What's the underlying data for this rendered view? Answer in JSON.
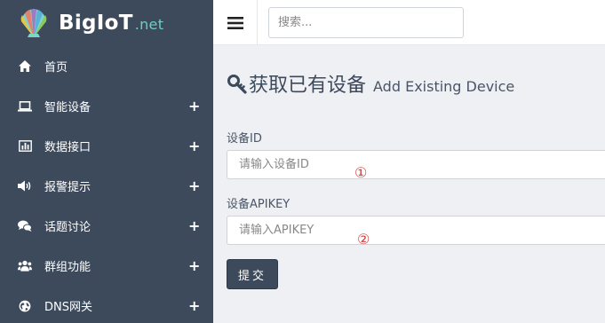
{
  "brand": {
    "name": "BigIoT",
    "suffix": ".net"
  },
  "sidebar": {
    "items": [
      {
        "label": "首页",
        "icon": "home-icon",
        "expandable": false
      },
      {
        "label": "智能设备",
        "icon": "laptop-icon",
        "expandable": true,
        "plus": "+"
      },
      {
        "label": "数据接口",
        "icon": "bar-chart-icon",
        "expandable": true,
        "plus": "+"
      },
      {
        "label": "报警提示",
        "icon": "volume-icon",
        "expandable": true,
        "plus": "+"
      },
      {
        "label": "话题讨论",
        "icon": "comments-icon",
        "expandable": true,
        "plus": "+"
      },
      {
        "label": "群组功能",
        "icon": "users-icon",
        "expandable": true,
        "plus": "+"
      },
      {
        "label": "DNS网关",
        "icon": "globe-icon",
        "expandable": true,
        "plus": "+"
      }
    ]
  },
  "topbar": {
    "search_placeholder": "搜索..."
  },
  "page": {
    "title": "获取已有设备",
    "subtitle": "Add Existing Device"
  },
  "form": {
    "device_id_label": "设备ID",
    "device_id_placeholder": "请输入设备ID",
    "apikey_label": "设备APIKEY",
    "apikey_placeholder": "请输入APIKEY",
    "submit_label": "提交",
    "markers": [
      "①",
      "②"
    ]
  },
  "colors": {
    "sidebar_bg": "#3d4a5c",
    "accent": "#6ccfc0",
    "marker": "#d23c3c",
    "page_bg": "#eef0f4"
  }
}
